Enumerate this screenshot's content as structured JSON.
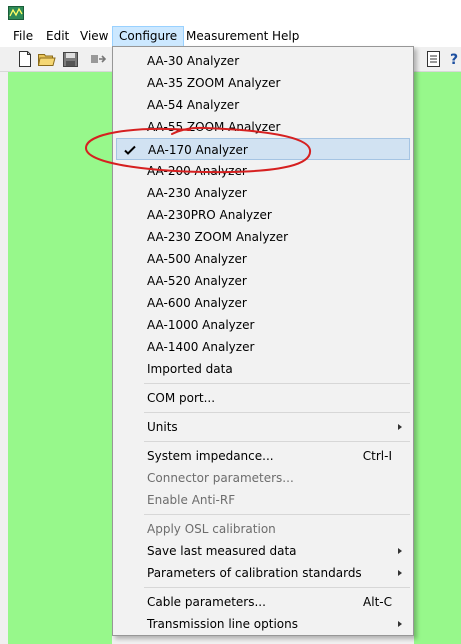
{
  "menubar": {
    "items": [
      {
        "label": "File"
      },
      {
        "label": "Edit"
      },
      {
        "label": "View"
      },
      {
        "label": "Configure"
      },
      {
        "label": "Measurement"
      },
      {
        "label": "Help"
      }
    ]
  },
  "toolbar": {
    "icons": [
      "new-file-icon",
      "open-folder-icon",
      "save-icon",
      "export-icon",
      "copy-icon",
      "help-icon"
    ]
  },
  "colors": {
    "plot_background": "#97f88b",
    "selection_highlight": "#d1e2f2",
    "annotation": "#d62020"
  },
  "configure_menu": {
    "analyzers": [
      {
        "label": "AA-30 Analyzer"
      },
      {
        "label": "AA-35 ZOOM Analyzer"
      },
      {
        "label": "AA-54 Analyzer"
      },
      {
        "label": "AA-55 ZOOM Analyzer"
      },
      {
        "label": "AA-170 Analyzer",
        "checked": true
      },
      {
        "label": "AA-200 Analyzer"
      },
      {
        "label": "AA-230 Analyzer"
      },
      {
        "label": "AA-230PRO Analyzer"
      },
      {
        "label": "AA-230 ZOOM Analyzer"
      },
      {
        "label": "AA-500 Analyzer"
      },
      {
        "label": "AA-520 Analyzer"
      },
      {
        "label": "AA-600 Analyzer"
      },
      {
        "label": "AA-1000 Analyzer"
      },
      {
        "label": "AA-1400 Analyzer"
      },
      {
        "label": "Imported data"
      }
    ],
    "com_port": "COM port...",
    "units": "Units",
    "system_impedance": "System impedance...",
    "system_impedance_shortcut": "Ctrl-I",
    "connector_parameters": "Connector parameters...",
    "enable_anti_rf": "Enable Anti-RF",
    "apply_osl": "Apply OSL calibration",
    "save_last_measured": "Save last measured data",
    "calibration_standards": "Parameters of calibration standards",
    "cable_parameters": "Cable parameters...",
    "cable_parameters_shortcut": "Alt-C",
    "transmission_line_options": "Transmission line options"
  }
}
